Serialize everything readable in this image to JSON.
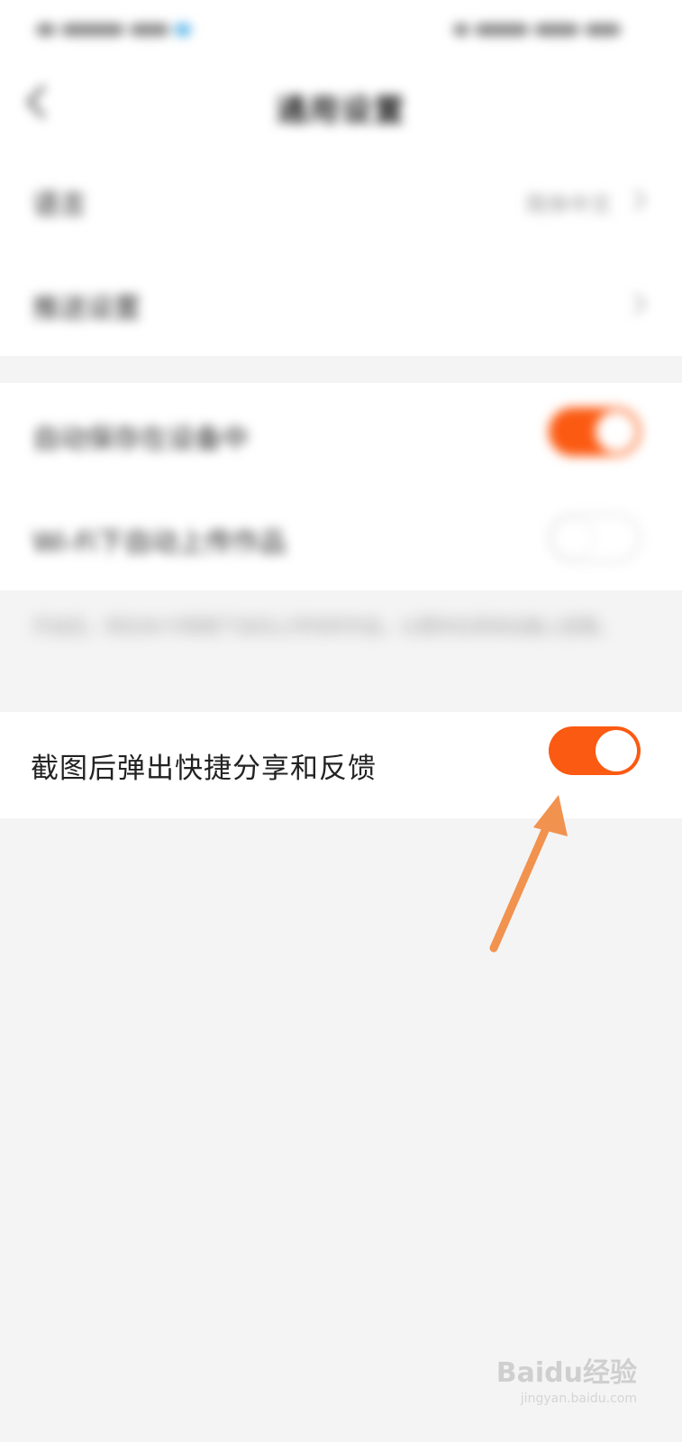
{
  "status_bar": {},
  "header": {
    "title": "通用设置"
  },
  "group1": {
    "items": [
      {
        "label": "语言",
        "value": "简体中文"
      },
      {
        "label": "推送设置",
        "value": ""
      }
    ]
  },
  "group2": {
    "items": [
      {
        "label": "自动保存在设备中",
        "toggle": "on"
      },
      {
        "label": "Wi-Fi下自动上传作品",
        "toggle": "off"
      }
    ],
    "note": "开启后，将在Wi-Fi网络下自动上传你的作品，以便你在其他设备上查看。"
  },
  "group3": {
    "label": "截图后弹出快捷分享和反馈",
    "toggle": "on"
  },
  "colors": {
    "accent": "#fb5a12",
    "arrow": "#f2924f",
    "background": "#f4f4f4"
  },
  "watermark": {
    "main": "Baidu经验",
    "sub": "jingyan.baidu.com"
  }
}
